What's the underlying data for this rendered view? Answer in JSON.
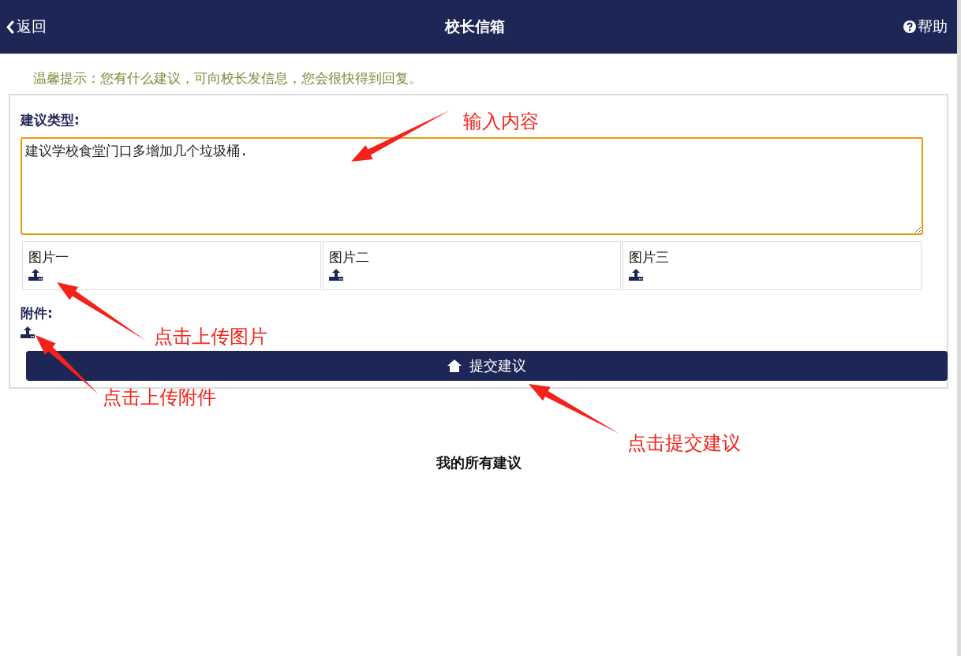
{
  "header": {
    "back_label": "返回",
    "title": "校长信箱",
    "help_label": "帮助"
  },
  "notice": "温馨提示：您有什么建议，可向校长发信息，您会很快得到回复。",
  "form": {
    "type_label": "建议类型:",
    "content": "建议学校食堂门口多增加几个垃圾桶.",
    "image_slots": [
      {
        "label": "图片一"
      },
      {
        "label": "图片二"
      },
      {
        "label": "图片三"
      }
    ],
    "attachment_label": "附件:",
    "submit_label": "提交建议"
  },
  "section_title": "我的所有建议",
  "annotations": [
    {
      "text": "输入内容"
    },
    {
      "text": "点击上传图片"
    },
    {
      "text": "点击上传附件"
    },
    {
      "text": "点击提交建议"
    }
  ]
}
